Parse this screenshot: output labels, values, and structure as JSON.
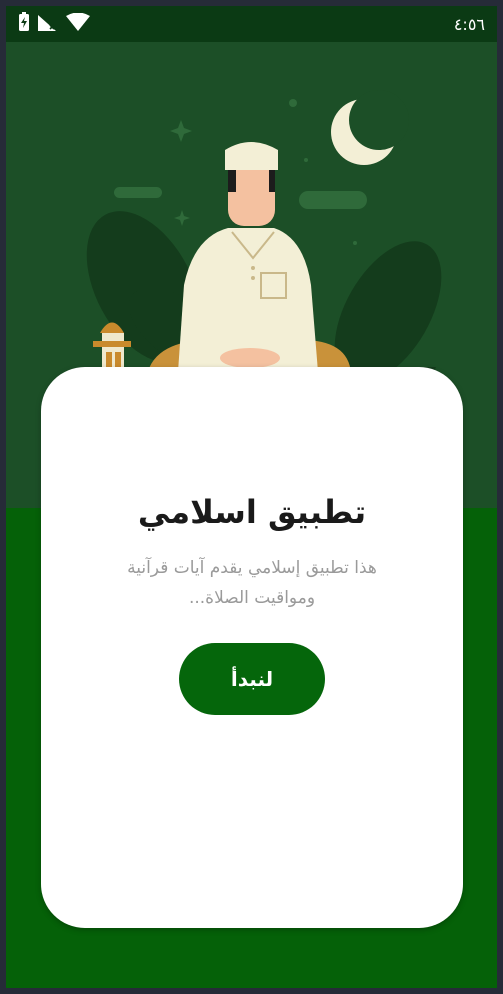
{
  "status_bar": {
    "time": "٤:٥٦",
    "icons": [
      "battery-charging-icon",
      "signal-icon",
      "wifi-icon"
    ]
  },
  "hero": {
    "illustration": "praying-man-illustration",
    "moon": "crescent-moon-icon",
    "lantern": "lantern-icon"
  },
  "card": {
    "title": "تطبيق اسلامي",
    "description": "هذا تطبيق إسلامي يقدم آيات قرآنية ومواقيت الصلاة...",
    "button_label": "لنبدأ"
  },
  "colors": {
    "primary_green": "#05660b",
    "hero_bg": "#1c4f27",
    "status_bar_bg": "#0b3a14",
    "card_bg": "#ffffff",
    "desc_text": "#9a9a9a"
  }
}
